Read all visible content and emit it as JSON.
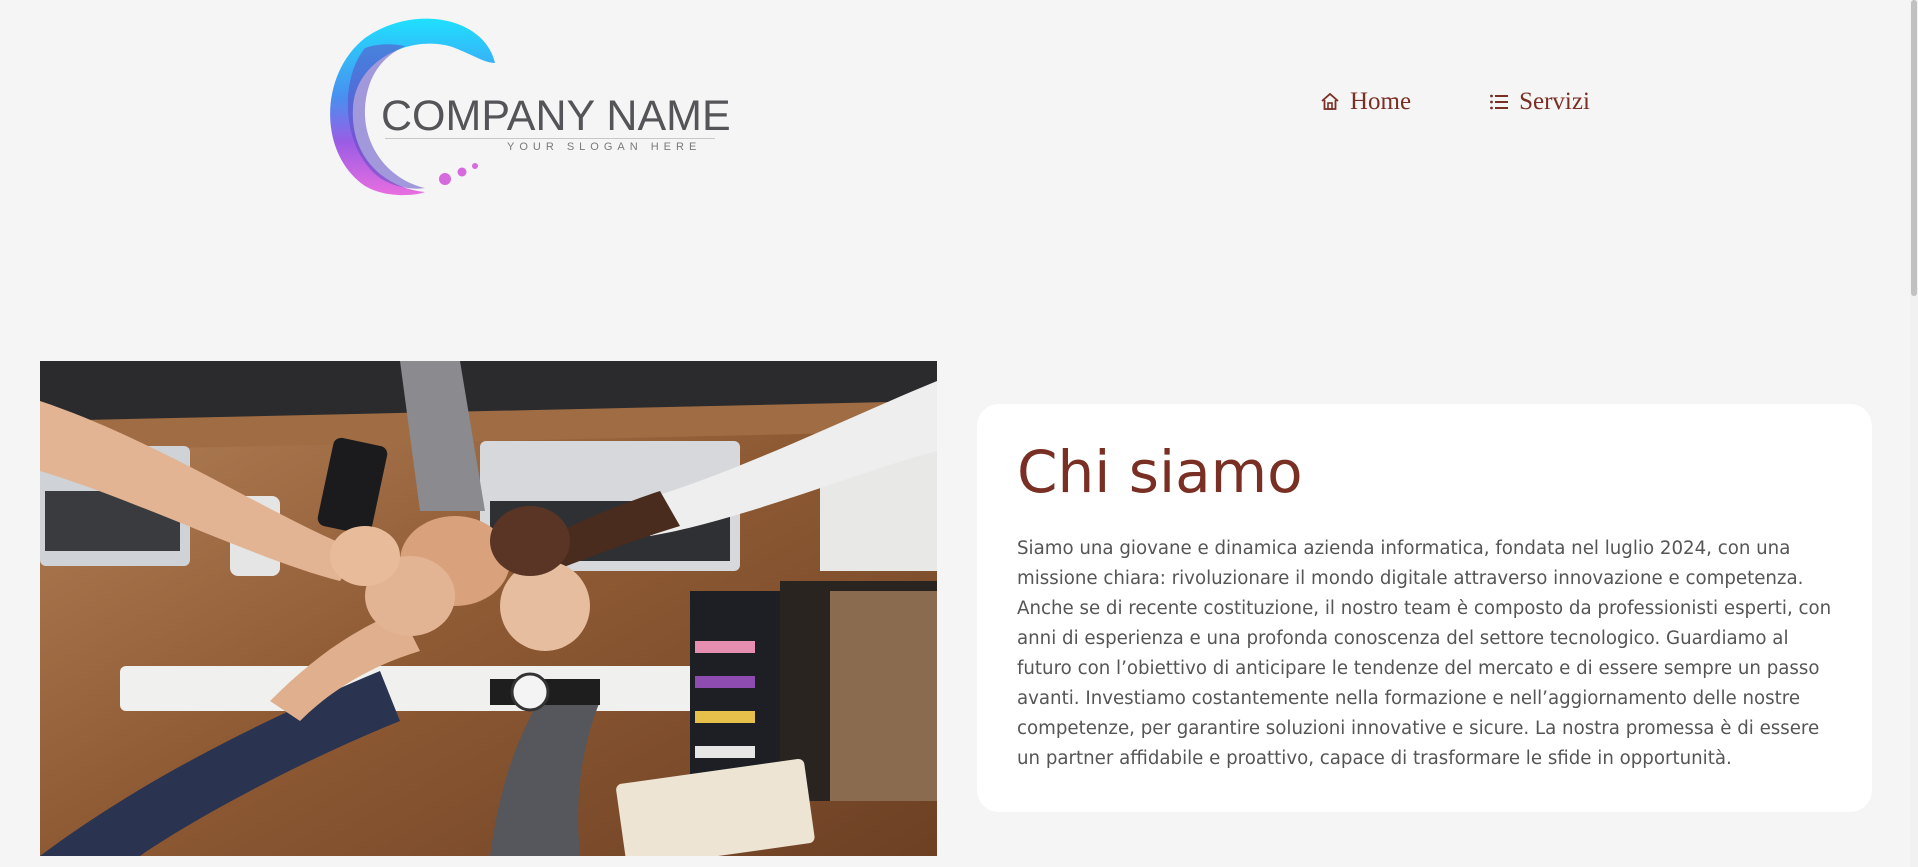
{
  "logo": {
    "name": "COMPANY NAME",
    "slogan": "YOUR SLOGAN HERE"
  },
  "nav": {
    "items": [
      {
        "label": "Home",
        "icon": "home-icon"
      },
      {
        "label": "Servizi",
        "icon": "list-icon"
      }
    ]
  },
  "about": {
    "title": "Chi siamo",
    "text": "Siamo una giovane e dinamica azienda informatica, fondata nel luglio 2024, con una missione chiara: rivoluzionare il mondo digitale attraverso innovazione e competenza. Anche se di recente costituzione, il nostro team è composto da professionisti esperti, con anni di esperienza e una profonda conoscenza del settore tecnologico. Guardiamo al futuro con l’obiettivo di anticipare le tendenze del mercato e di essere sempre un passo avanti. Investiamo costantemente nella formazione e nell’aggiornamento delle nostre competenze, per garantire soluzioni innovative e sicure. La nostra promessa è di essere un partner affidabile e proattivo, capace di trasformare le sfide in opportunità."
  },
  "colors": {
    "accent": "#7a2f24",
    "background": "#f5f5f5",
    "card": "#ffffff",
    "body_text": "#555555"
  }
}
